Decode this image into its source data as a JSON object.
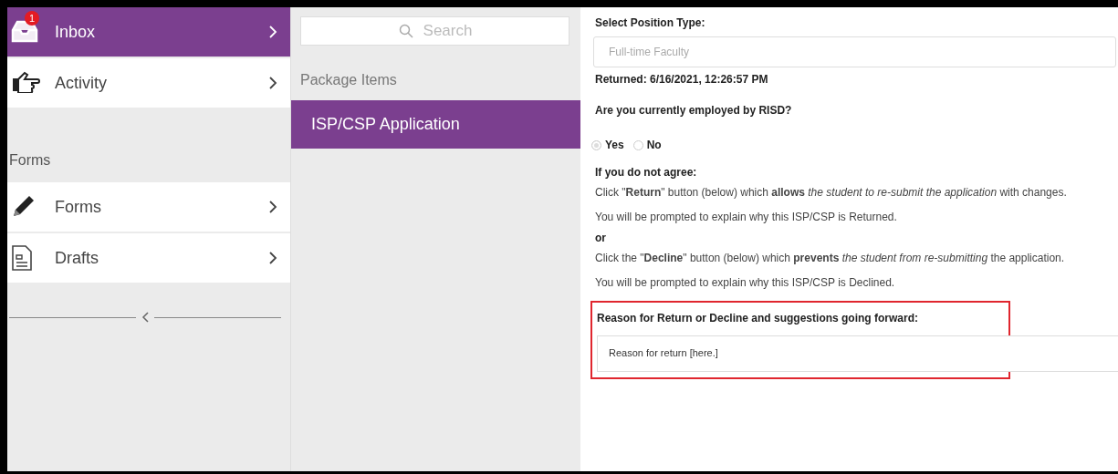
{
  "sidebar": {
    "items": [
      {
        "label": "Inbox",
        "kind": "inbox",
        "badge": "1",
        "selected": true
      },
      {
        "label": "Activity",
        "kind": "hand",
        "selected": false
      }
    ],
    "section_title": "Forms",
    "section_items": [
      {
        "label": "Forms",
        "kind": "pencil",
        "selected": false
      },
      {
        "label": "Drafts",
        "kind": "document",
        "selected": false
      }
    ]
  },
  "middle": {
    "search": {
      "placeholder": "Search"
    },
    "heading": "Package Items",
    "items": [
      {
        "label": "ISP/CSP Application",
        "selected": true
      }
    ]
  },
  "form": {
    "position_label": "Select Position Type:",
    "position_value": "Full-time Faculty",
    "returned": "Returned: 6/16/2021, 12:26:57 PM",
    "employed_question": "Are you currently employed by RISD?",
    "employed_options": [
      {
        "label": "Yes",
        "selected": true
      },
      {
        "label": "No",
        "selected": false
      }
    ],
    "instructions": [
      {
        "kind": "heading",
        "text": "If you do not agree:"
      },
      {
        "kind": "text",
        "text": "Click \"**Return**\" button (below) which **allows** *the student to re-submit the application* with changes."
      },
      {
        "kind": "text",
        "text": "You will be prompted to explain why this ISP/CSP is Returned."
      },
      {
        "kind": "heading",
        "text": "or"
      },
      {
        "kind": "text",
        "text": "Click the \"**Decline**\" button (below) which **prevents** *the student from re-submitting* the application."
      },
      {
        "kind": "text",
        "text": "You will be prompted to explain why this ISP/CSP is Declined."
      }
    ],
    "reason_label": "Reason for Return or Decline and suggestions going forward:",
    "reason_value": "Reason for return [here.]"
  }
}
